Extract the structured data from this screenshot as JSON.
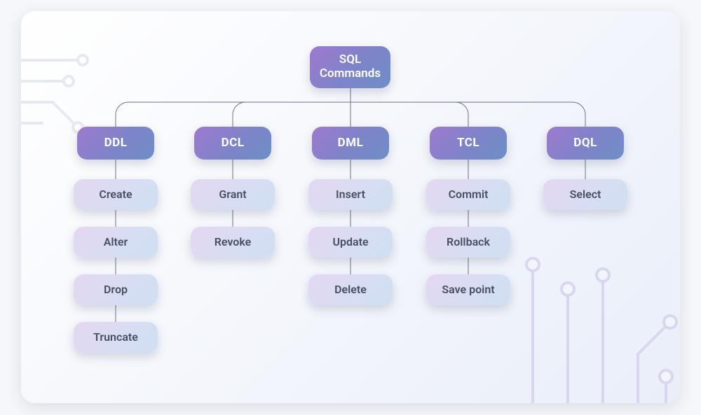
{
  "root": {
    "label": "SQL\nCommands"
  },
  "categories": [
    {
      "key": "ddl",
      "label": "DDL",
      "items": [
        "Create",
        "Alter",
        "Drop",
        "Truncate"
      ]
    },
    {
      "key": "dcl",
      "label": "DCL",
      "items": [
        "Grant",
        "Revoke"
      ]
    },
    {
      "key": "dml",
      "label": "DML",
      "items": [
        "Insert",
        "Update",
        "Delete"
      ]
    },
    {
      "key": "tcl",
      "label": "TCL",
      "items": [
        "Commit",
        "Rollback",
        "Save point"
      ]
    },
    {
      "key": "dql",
      "label": "DQL",
      "items": [
        "Select"
      ]
    }
  ],
  "colors": {
    "cat_gradient_from": "#9f79cf",
    "cat_gradient_to": "#6f8ec6",
    "leaf_gradient_from": "#e5d7f1",
    "leaf_gradient_to": "#cfe0f2",
    "connector": "#6a7385"
  }
}
